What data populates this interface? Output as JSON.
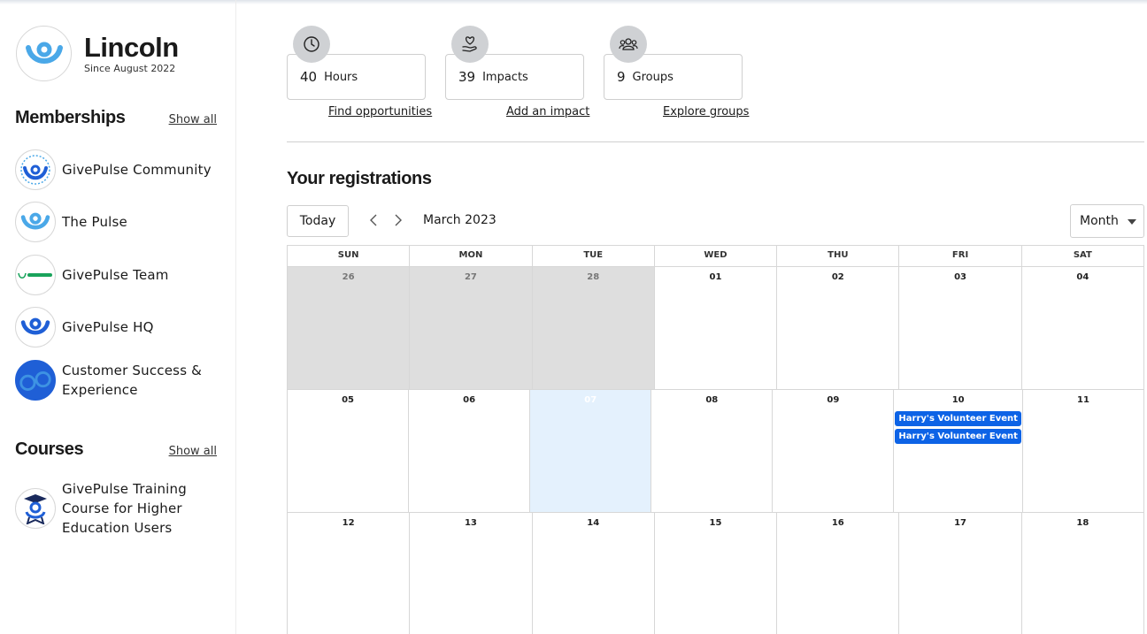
{
  "profile": {
    "name": "Lincoln",
    "since": "Since August 2022"
  },
  "memberships": {
    "title": "Memberships",
    "show_all": "Show all",
    "items": [
      {
        "label": "GivePulse Community",
        "icon": "givepulse-community-logo"
      },
      {
        "label": "The Pulse",
        "icon": "givepulse-logo"
      },
      {
        "label": "GivePulse Team",
        "icon": "givepulse-wordmark-logo"
      },
      {
        "label": "GivePulse HQ",
        "icon": "givepulse-hq-logo"
      },
      {
        "label": "Customer Success & Experience",
        "icon": "customer-success-logo"
      }
    ]
  },
  "courses": {
    "title": "Courses",
    "show_all": "Show all",
    "items": [
      {
        "label": "GivePulse Training Course for Higher Education Users",
        "icon": "graduate-logo"
      }
    ]
  },
  "stats": [
    {
      "value": "40",
      "label": "Hours",
      "link": "Find opportunities",
      "icon": "clock-icon"
    },
    {
      "value": "39",
      "label": "Impacts",
      "link": "Add an impact",
      "icon": "heart-hand-icon"
    },
    {
      "value": "9",
      "label": "Groups",
      "link": "Explore groups",
      "icon": "people-icon"
    }
  ],
  "registrations": {
    "title": "Your registrations",
    "today_label": "Today",
    "month_label": "March 2023",
    "view_label": "Month",
    "weekdays": [
      "SUN",
      "MON",
      "TUE",
      "WED",
      "THU",
      "FRI",
      "SAT"
    ],
    "weeks": [
      [
        "26",
        "27",
        "28",
        "01",
        "02",
        "03",
        "04"
      ],
      [
        "05",
        "06",
        "07",
        "08",
        "09",
        "10",
        "11"
      ],
      [
        "12",
        "13",
        "14",
        "15",
        "16",
        "17",
        "18"
      ]
    ],
    "events": [
      "Harry's Volunteer Event",
      "Harry's Volunteer Event"
    ]
  },
  "colors": {
    "brand_blue": "#0d63e6",
    "logo_light_blue": "#4aa8e8",
    "today_highlight": "#e4f1fd",
    "other_month": "#dedede"
  }
}
